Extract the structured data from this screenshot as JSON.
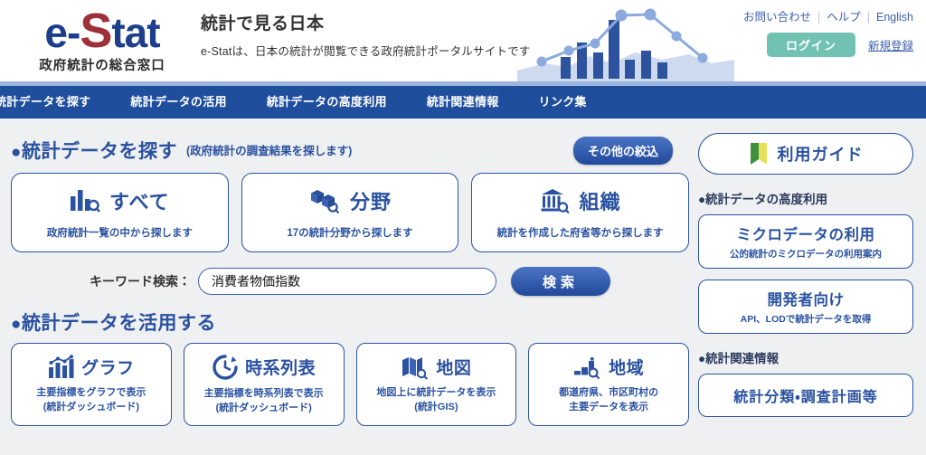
{
  "header": {
    "logo_main_1": "e-",
    "logo_main_s": "S",
    "logo_main_2": "tat",
    "logo_sub": "政府統計の総合窓口",
    "hero_title": "統計で見る日本",
    "hero_sub": "e-Statは、日本の統計が閲覧できる政府統計ポータルサイトです",
    "util_links": [
      {
        "label": "お問い合わせ",
        "name": "contact-link"
      },
      {
        "label": "ヘルプ",
        "name": "help-link"
      },
      {
        "label": "English",
        "name": "english-link"
      }
    ],
    "separator": "|",
    "login_label": "ログイン",
    "register_label": "新規登録"
  },
  "nav": {
    "items": [
      {
        "label": "統計データを探す",
        "name": "nav-item-search-data"
      },
      {
        "label": "統計データの活用",
        "name": "nav-item-use-data"
      },
      {
        "label": "統計データの高度利用",
        "name": "nav-item-advanced-use"
      },
      {
        "label": "統計関連情報",
        "name": "nav-item-related-info"
      },
      {
        "label": "リンク集",
        "name": "nav-item-links"
      }
    ]
  },
  "main": {
    "section1": {
      "dot": "●",
      "heading": "統計データを探す",
      "note": "(政府統計の調査結果を探します)",
      "filter_button": "その他の絞込",
      "cards": [
        {
          "title": "すべて",
          "sub": "政府統計一覧の中から探します",
          "icon": "bar-chart-search-icon",
          "name": "search-card-all"
        },
        {
          "title": "分野",
          "sub": "17の統計分野から探します",
          "icon": "boxes-search-icon",
          "name": "search-card-field"
        },
        {
          "title": "組織",
          "sub": "統計を作成した府省等から探します",
          "icon": "government-building-search-icon",
          "name": "search-card-organization"
        }
      ]
    },
    "search": {
      "label": "キーワード検索：",
      "value": "消費者物価指数",
      "placeholder": "",
      "button": "検索"
    },
    "section2": {
      "dot": "●",
      "heading": "統計データを活用する",
      "cards": [
        {
          "title": "グラフ",
          "sub1": "主要指標をグラフで表示",
          "sub2": "(統計ダッシュボード)",
          "icon": "graph-icon",
          "name": "use-card-graph"
        },
        {
          "title": "時系列表",
          "sub1": "主要指標を時系列表で表示",
          "sub2": "(統計ダッシュボード)",
          "icon": "clock-icon",
          "name": "use-card-timeseries"
        },
        {
          "title": "地図",
          "sub1": "地図上に統計データを表示",
          "sub2": "(統計GIS)",
          "icon": "map-search-icon",
          "name": "use-card-map"
        },
        {
          "title": "地域",
          "sub1": "都道府県、市区町村の",
          "sub2": "主要データを表示",
          "icon": "region-search-icon",
          "name": "use-card-region"
        }
      ]
    }
  },
  "sidebar": {
    "guide_label": "利用ガイド",
    "guide_icon": "beginner-leaf-icon",
    "section_advanced": {
      "heading": "●統計データの高度利用",
      "cards": [
        {
          "title": "ミクロデータの利用",
          "sub": "公的統計のミクロデータの利用案内",
          "name": "sidebar-card-microdata"
        },
        {
          "title": "開発者向け",
          "sub": "API、LODで統計データを取得",
          "name": "sidebar-card-developer"
        }
      ]
    },
    "section_related": {
      "heading": "●統計関連情報",
      "cards": [
        {
          "title": "統計分類・調査計画等",
          "name": "sidebar-card-classification"
        }
      ]
    }
  },
  "colors": {
    "nav_blue": "#1f4e9c",
    "nav_strip": "#9db6e0",
    "accent_blue": "#2a52a0",
    "login_teal": "#72c2b4",
    "logo_red": "#9e3039",
    "page_bg": "#eff0f2"
  }
}
